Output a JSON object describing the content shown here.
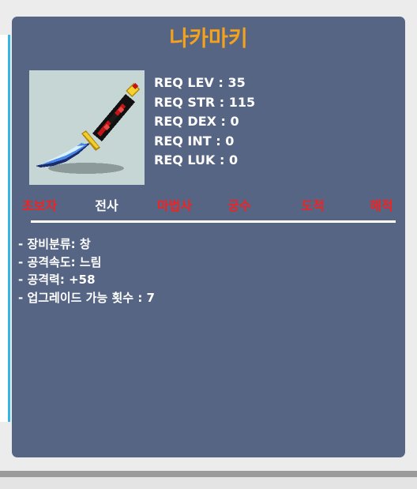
{
  "item": {
    "name": "나카마키",
    "icon": "curved-dagger-sword-icon"
  },
  "requirements": [
    "REQ LEV : 35",
    "REQ STR : 115",
    "REQ DEX : 0",
    "REQ INT : 0",
    "REQ LUK : 0"
  ],
  "jobs": [
    {
      "label": "초보자",
      "allowed": false
    },
    {
      "label": "전사",
      "allowed": true
    },
    {
      "label": "마법사",
      "allowed": false
    },
    {
      "label": "궁수",
      "allowed": false
    },
    {
      "label": "도적",
      "allowed": false
    },
    {
      "label": "해적",
      "allowed": false
    }
  ],
  "stats": [
    "- 장비분류: 창",
    "- 공격속도: 느림",
    "- 공격력: +58",
    "- 업그레이드 가능 횟수 : 7"
  ],
  "colors": {
    "card_bg": "#566584",
    "title": "#f3a21d",
    "job_disallowed": "#f02323",
    "job_allowed": "#ffffff"
  }
}
